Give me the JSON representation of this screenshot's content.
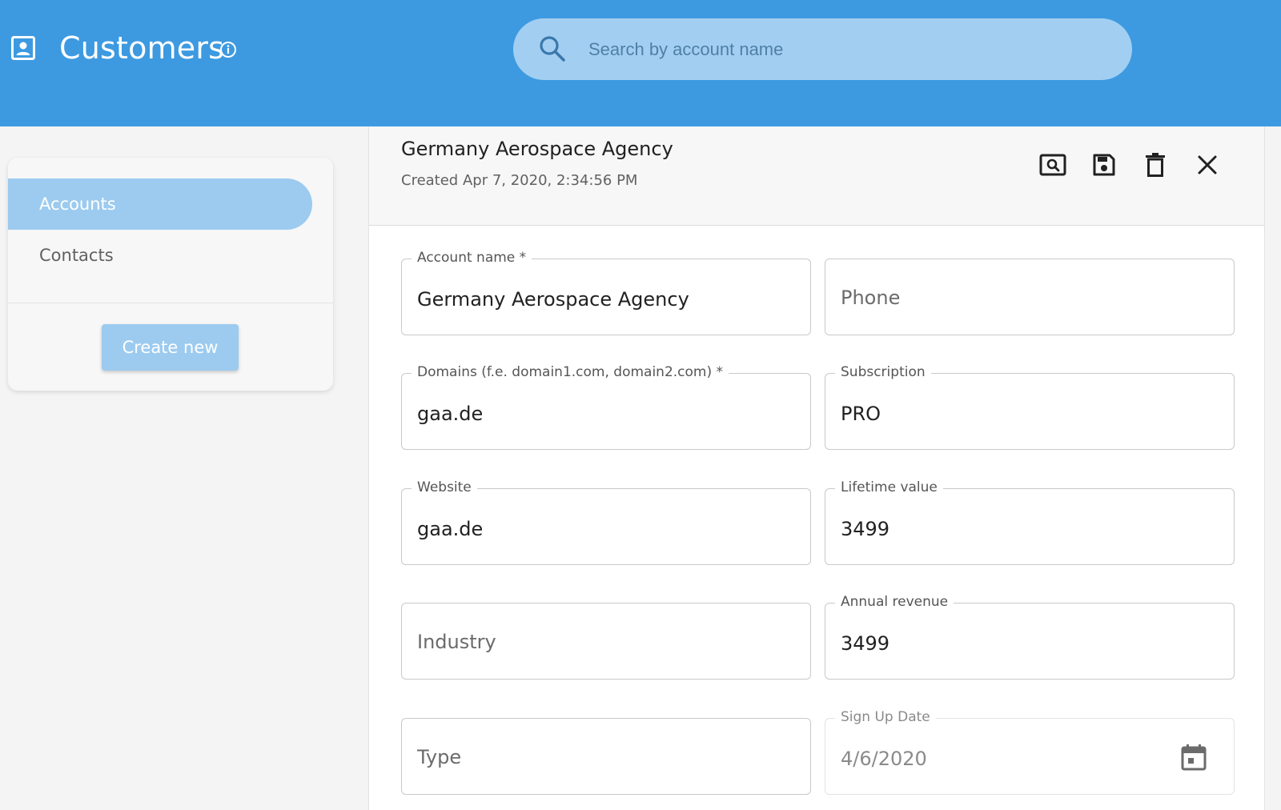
{
  "header": {
    "app_icon": "contact-card-icon",
    "title": "Customers",
    "info_icon": "info-icon",
    "search_placeholder": "Search by account name",
    "search_icon": "search-icon",
    "background": "#3d9ae1"
  },
  "sidebar": {
    "items": [
      {
        "label": "Accounts",
        "active": true
      },
      {
        "label": "Contacts",
        "active": false
      }
    ],
    "create_button_label": "Create new",
    "accent": "#9ccbef"
  },
  "record": {
    "title": "Germany Aerospace Agency",
    "created": "Created Apr 7, 2020, 2:34:56 PM",
    "toolbar_icons": [
      "preview-icon",
      "save-icon",
      "delete-icon",
      "close-icon"
    ]
  },
  "form": {
    "account_name": {
      "label": "Account name *",
      "value": "Germany Aerospace Agency"
    },
    "phone": {
      "placeholder": "Phone"
    },
    "domains": {
      "label": "Domains (f.e. domain1.com, domain2.com) *",
      "value": "gaa.de"
    },
    "subscription": {
      "label": "Subscription",
      "value": "PRO"
    },
    "website": {
      "label": "Website",
      "value": "gaa.de"
    },
    "lifetime_value": {
      "label": "Lifetime value",
      "value": "3499"
    },
    "industry": {
      "placeholder": "Industry"
    },
    "annual_revenue": {
      "label": "Annual revenue",
      "value": "3499"
    },
    "type": {
      "placeholder": "Type"
    },
    "sign_up_date": {
      "label": "Sign Up Date",
      "value": "4/6/2020",
      "icon": "calendar-icon"
    }
  }
}
